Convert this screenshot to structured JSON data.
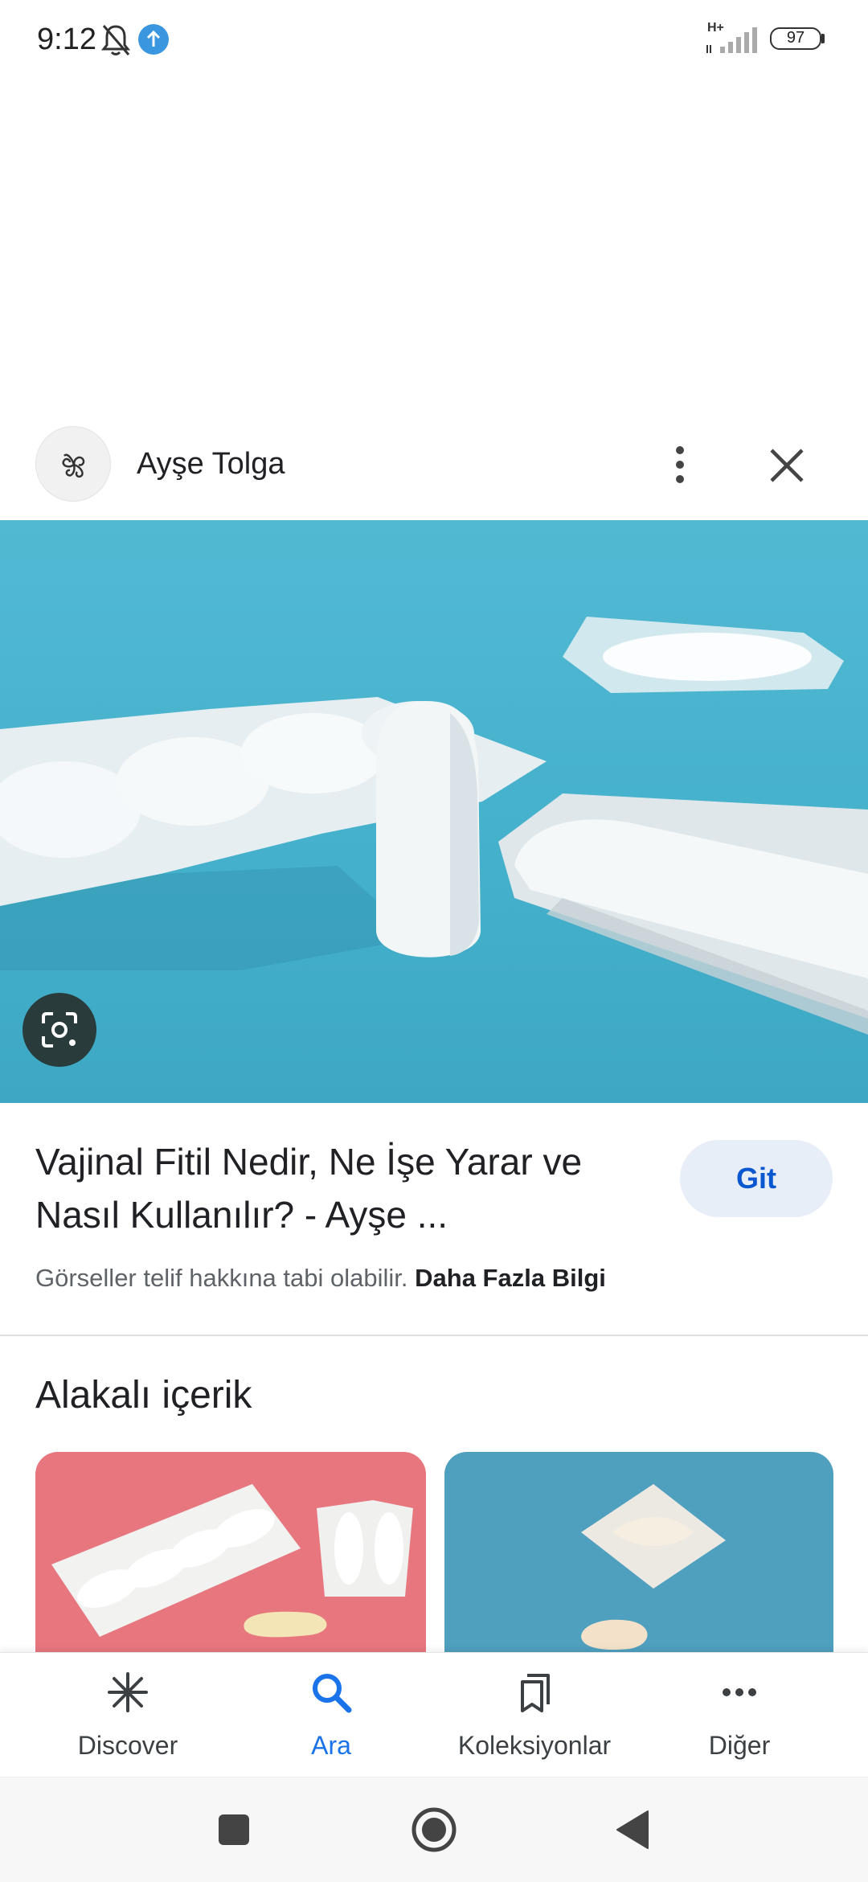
{
  "status_bar": {
    "time": "9:12",
    "network": "H+",
    "battery": "97"
  },
  "header": {
    "site_name": "Ayşe Tolga"
  },
  "result": {
    "title": "Vajinal Fitil Nedir, Ne İşe Yarar ve Nasıl Kullanılır? - Ayşe ...",
    "visit_label": "Git",
    "copyright_text": "Görseller telif hakkına tabi olabilir.",
    "more_info_label": "Daha Fazla Bilgi"
  },
  "related": {
    "heading": "Alakalı içerik"
  },
  "bottom_nav": {
    "items": [
      {
        "label": "Discover",
        "icon": "asterisk-icon"
      },
      {
        "label": "Ara",
        "icon": "search-icon",
        "active": true
      },
      {
        "label": "Koleksiyonlar",
        "icon": "bookmarks-icon"
      },
      {
        "label": "Diğer",
        "icon": "more-horizontal-icon"
      }
    ]
  },
  "colors": {
    "accent": "#1a73e8",
    "hero_background": "#4cb4cf",
    "button_background": "#e8eef8"
  }
}
